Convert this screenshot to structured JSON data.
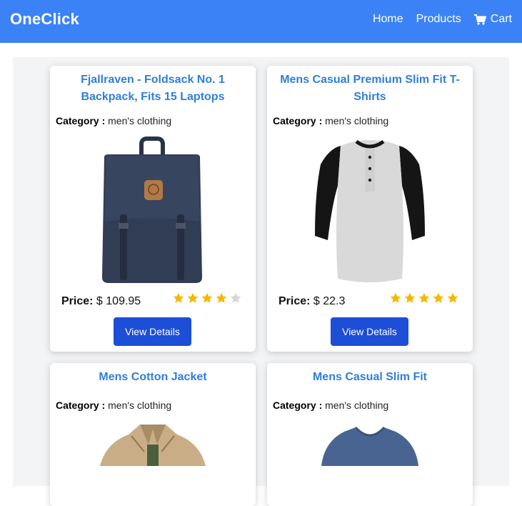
{
  "navbar": {
    "brand": "OneClick",
    "links": [
      "Home",
      "Products"
    ],
    "cart_label": "Cart"
  },
  "colors": {
    "nav_bg": "#3b82f6",
    "title": "#2f7fd8",
    "button": "#1d4ed8",
    "star": "#f5b800",
    "star_empty": "#d6d6d6"
  },
  "labels": {
    "category": "Category :",
    "price": "Price:",
    "view_details": "View Details"
  },
  "products": [
    {
      "title": "Fjallraven - Foldsack No. 1 Backpack, Fits 15 Laptops",
      "category": "men's clothing",
      "price": "$ 109.95",
      "rating": 4
    },
    {
      "title": "Mens Casual Premium Slim Fit T-Shirts",
      "category": "men's clothing",
      "price": "$ 22.3",
      "rating": 5
    },
    {
      "title": "Mens Cotton Jacket",
      "category": "men's clothing"
    },
    {
      "title": "Mens Casual Slim Fit",
      "category": "men's clothing"
    }
  ]
}
